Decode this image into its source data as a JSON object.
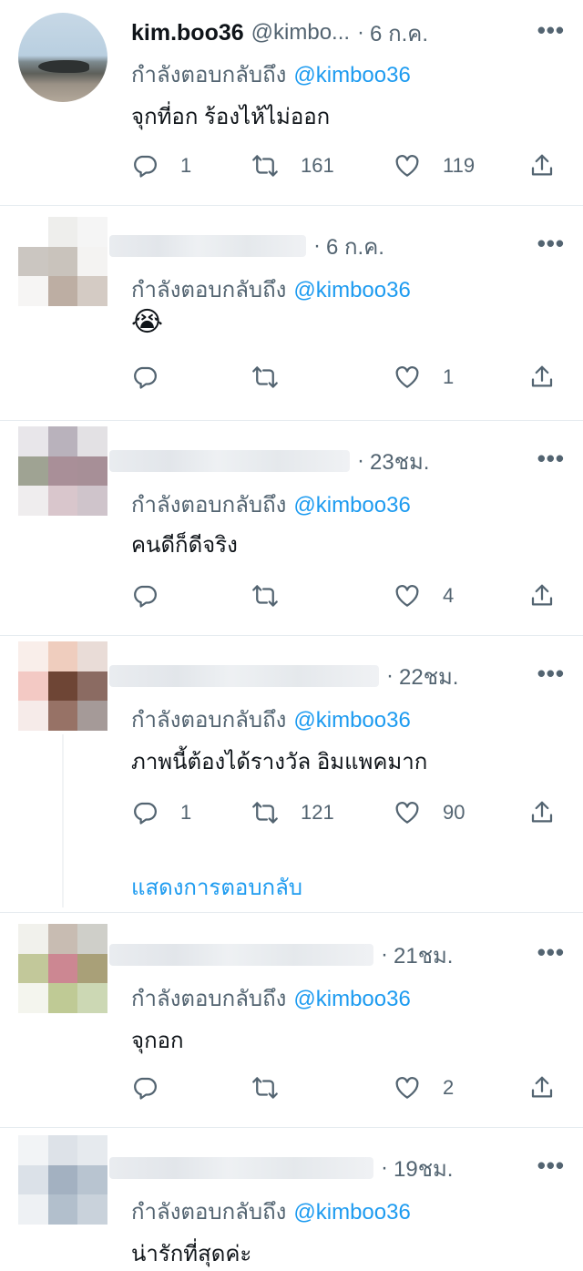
{
  "reply_prefix": "กำลังตอบกลับถึง",
  "mention": "@kimboo36",
  "colors": {
    "accent": "#1d9bf0",
    "secondary_text": "#536471",
    "divider": "#e6ecf0"
  },
  "tweets": [
    {
      "name": "kim.boo36",
      "handle": "@kimbo...",
      "time": "6 ก.ค.",
      "text": "จุกที่อก ร้องไห้ไม่ออก",
      "replies": "1",
      "retweets": "161",
      "likes": "119"
    },
    {
      "time": "6 ก.ค.",
      "text": "😭",
      "replies": "",
      "retweets": "",
      "likes": "1"
    },
    {
      "time": "23ชม.",
      "text": "คนดีก็ดีจริง",
      "replies": "",
      "retweets": "",
      "likes": "4"
    },
    {
      "time": "22ชม.",
      "text": "ภาพนี้ต้องได้รางวัล อิมแพคมาก",
      "replies": "1",
      "retweets": "121",
      "likes": "90",
      "show_replies": "แสดงการตอบกลับ"
    },
    {
      "time": "21ชม.",
      "text": "จุกอก",
      "replies": "",
      "retweets": "",
      "likes": "2"
    },
    {
      "time": "19ชม.",
      "text": "น่ารักที่สุดค่ะ"
    }
  ]
}
